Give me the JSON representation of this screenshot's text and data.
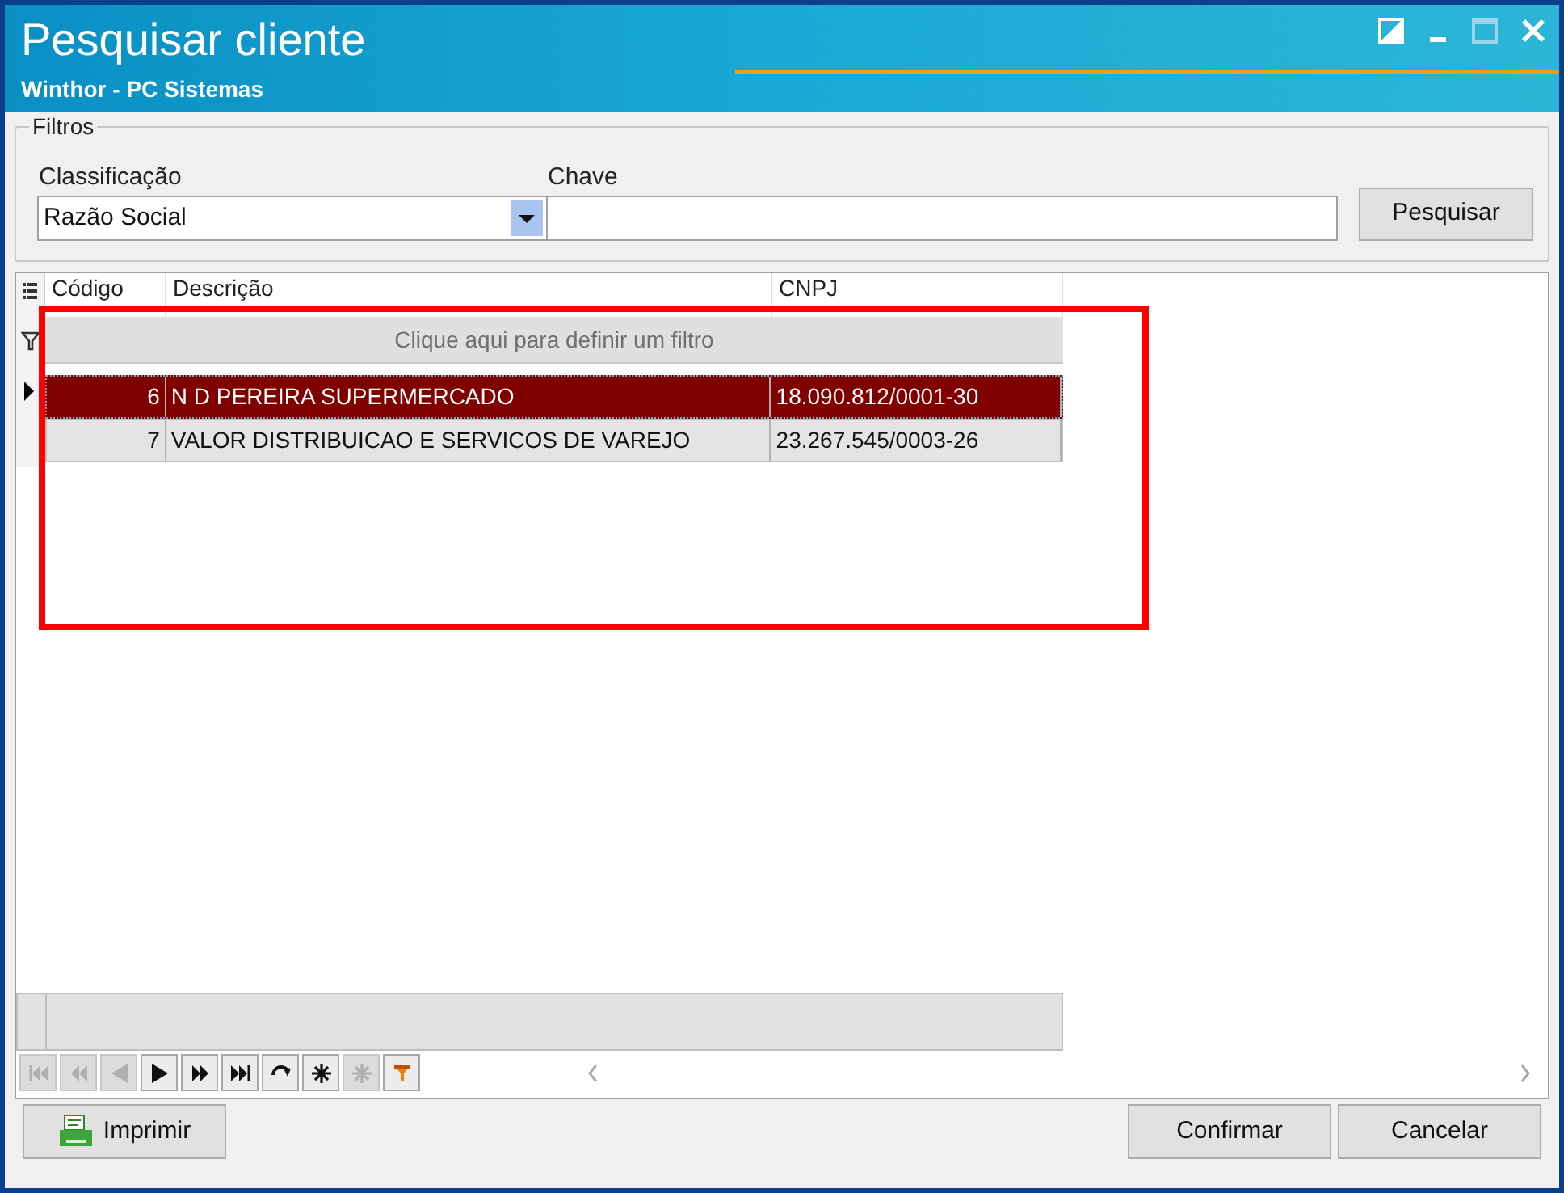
{
  "window": {
    "title": "Pesquisar cliente",
    "subtitle": "Winthor - PC Sistemas"
  },
  "filters": {
    "legend": "Filtros",
    "classification_label": "Classificação",
    "classification_value": "Razão Social",
    "key_label": "Chave",
    "search_button": "Pesquisar"
  },
  "grid": {
    "columns": [
      "Código",
      "Descrição",
      "CNPJ"
    ],
    "filter_prompt": "Clique aqui para definir um filtro",
    "rows": [
      {
        "cells": [
          "6",
          "N D PEREIRA SUPERMERCADO",
          "18.090.812/0001-30"
        ],
        "selected": true
      },
      {
        "cells": [
          "7",
          "VALOR DISTRIBUICAO E SERVICOS DE VAREJO",
          "23.267.545/0003-26"
        ],
        "selected": false
      }
    ]
  },
  "navigator": [
    {
      "kind": "first",
      "disabled": true
    },
    {
      "kind": "prev-page",
      "disabled": true
    },
    {
      "kind": "prev",
      "disabled": true
    },
    {
      "kind": "next",
      "disabled": false
    },
    {
      "kind": "next-page",
      "disabled": false
    },
    {
      "kind": "last",
      "disabled": false
    },
    {
      "kind": "refresh",
      "disabled": false
    },
    {
      "kind": "star",
      "disabled": false
    },
    {
      "kind": "star",
      "disabled": true
    },
    {
      "kind": "filter",
      "disabled": false
    }
  ],
  "highlight": {
    "shown": true
  },
  "buttons": {
    "print": "Imprimir",
    "confirm": "Confirmar",
    "cancel": "Cancelar"
  }
}
